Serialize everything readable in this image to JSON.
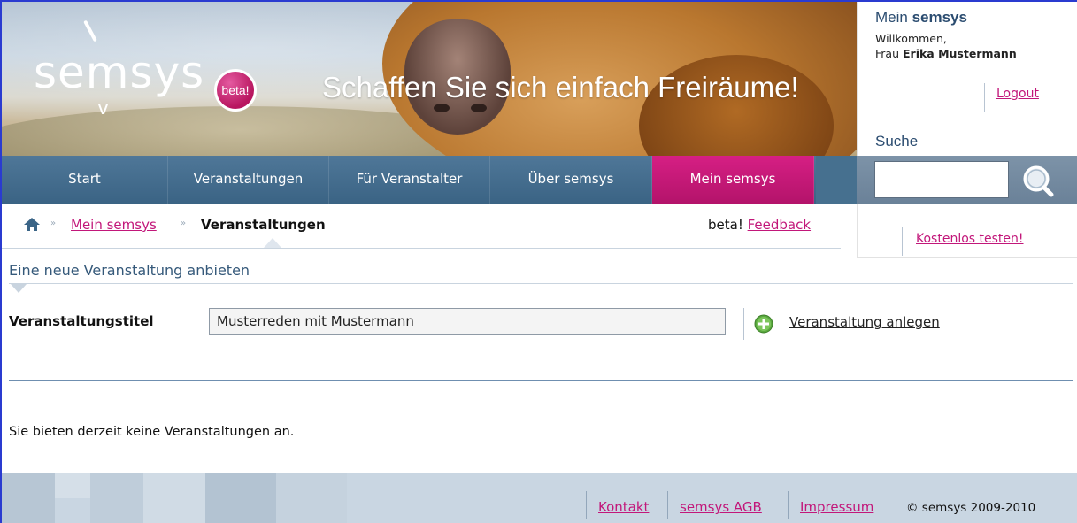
{
  "header": {
    "logo_text": "semsys",
    "badge": "beta!",
    "slogan": "Schaffen Sie sich einfach Freiräume!"
  },
  "account": {
    "title_light": "Mein ",
    "title_bold": "semsys",
    "welcome": "Willkommen,",
    "salutation": "Frau ",
    "user_name": "Erika Mustermann",
    "logout": "Logout",
    "search_title": "Suche"
  },
  "search": {
    "value": ""
  },
  "nav": {
    "items": [
      {
        "label": "Start"
      },
      {
        "label": "Veranstaltungen"
      },
      {
        "label": "Für Veranstalter"
      },
      {
        "label": "Über semsys"
      },
      {
        "label": "Mein semsys"
      }
    ],
    "active_index": 4
  },
  "breadcrumb": {
    "sep": "»",
    "link": "Mein semsys",
    "current": "Veranstaltungen",
    "beta_text": "beta! ",
    "feedback": "Feedback"
  },
  "trial": {
    "link": "Kostenlos testen!"
  },
  "section": {
    "title": "Eine neue Veranstaltung anbieten"
  },
  "form": {
    "label": "Veranstaltungstitel",
    "value": "Musterreden mit Mustermann",
    "action": "Veranstaltung anlegen"
  },
  "empty_message": "Sie bieten derzeit keine Veranstaltungen an.",
  "footer": {
    "links": [
      "Kontakt",
      "semsys AGB",
      "Impressum"
    ],
    "copyright": "© semsys 2009-2010"
  },
  "colors": {
    "brand_pink": "#c2177a",
    "nav_blue": "#3a6384",
    "heading_blue": "#2b4c70"
  }
}
